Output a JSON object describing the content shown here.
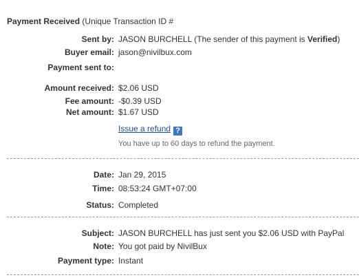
{
  "heading": {
    "title": "Payment Received",
    "subtitle": "(Unique Transaction ID #"
  },
  "sender": {
    "sent_by_label": "Sent by:",
    "sent_by_name": "JASON BURCHELL",
    "sent_by_note_prefix": "(The sender of this payment is",
    "sent_by_status": "Verified",
    "sent_by_note_suffix": ")",
    "buyer_email_label": "Buyer email:",
    "buyer_email": "jason@nivilbux.com",
    "payment_sent_to_label": "Payment sent to:",
    "payment_sent_to": ""
  },
  "amounts": {
    "received_label": "Amount received:",
    "received": "$2.06 USD",
    "fee_label": "Fee amount:",
    "fee": "-$0.39 USD",
    "net_label": "Net amount:",
    "net": "$1.67 USD",
    "refund_link": "Issue a refund",
    "help_icon": "?",
    "refund_note": "You have up to 60 days to refund the payment."
  },
  "details": {
    "date_label": "Date:",
    "date": "Jan 29, 2015",
    "time_label": "Time:",
    "time": "08:53:24 GMT+07:00",
    "status_label": "Status:",
    "status": "Completed"
  },
  "message": {
    "subject_label": "Subject:",
    "subject": "JASON BURCHELL has just sent you $2.06 USD with PayPal",
    "note_label": "Note:",
    "note": "You got paid by NivilBux",
    "payment_type_label": "Payment type:",
    "payment_type": "Instant"
  },
  "colors": {
    "text": "#333333",
    "link": "#1f4e9a",
    "help_icon_bg": "#3f79c5",
    "muted": "#666666",
    "divider": "#9a9a9a"
  }
}
